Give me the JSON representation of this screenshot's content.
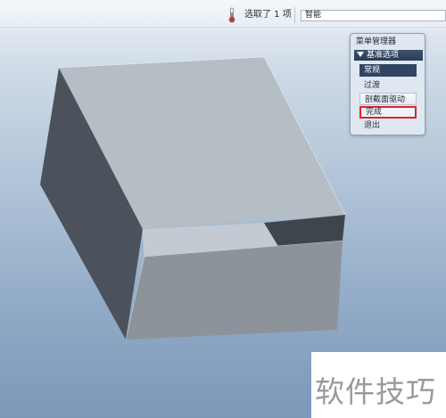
{
  "status_bar": {
    "selection_text": "选取了 1 项",
    "filter_value": "智能"
  },
  "menu_manager": {
    "title": "菜单管理器",
    "section_label": "基准选项",
    "items": [
      {
        "label": "常规",
        "state": "selected"
      },
      {
        "label": "过渡",
        "state": "normal"
      },
      {
        "label": "剖截面驱动",
        "state": "normal"
      },
      {
        "label": "完成",
        "state": "highlighted"
      },
      {
        "label": "退出",
        "state": "normal"
      }
    ]
  },
  "watermark": {
    "text": "软件技巧"
  },
  "colors": {
    "accent_dark": "#314563",
    "highlight_red": "#e0242b",
    "model_top": "#b4bcc4",
    "model_left": "#4b525b",
    "model_front": "#8a9199"
  },
  "icons": {
    "thermometer": "thermometer-icon",
    "section_toggle": "triangle-down-icon"
  }
}
